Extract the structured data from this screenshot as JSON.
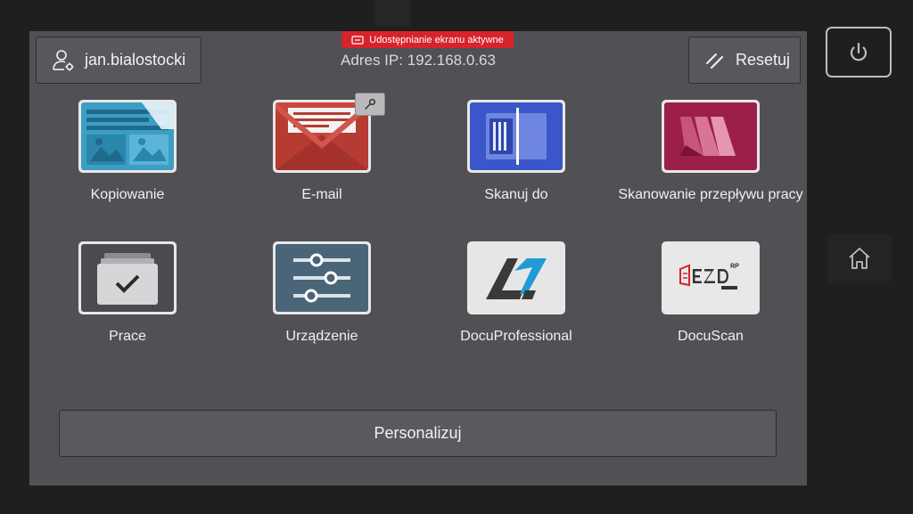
{
  "header": {
    "user_name": "jan.bialostocki",
    "ip_address": "Adres IP: 192.168.0.63",
    "share_banner": "Udostępnianie ekranu aktywne",
    "reset_label": "Resetuj"
  },
  "apps": [
    {
      "label": "Kopiowanie",
      "icon": "copy-icon"
    },
    {
      "label": "E-mail",
      "icon": "email-icon"
    },
    {
      "label": "Skanuj do",
      "icon": "scan-to-icon"
    },
    {
      "label": "Skanowanie przepływu pracy",
      "icon": "workflow-scan-icon"
    },
    {
      "label": "Prace",
      "icon": "jobs-icon"
    },
    {
      "label": "Urządzenie",
      "icon": "device-icon"
    },
    {
      "label": "DocuProfessional",
      "icon": "docuprofessional-logo"
    },
    {
      "label": "DocuScan",
      "icon": "docuscan-logo"
    }
  ],
  "footer": {
    "personalize_label": "Personalizuj"
  },
  "side": {
    "power_icon": "power-icon",
    "home_icon": "home-icon"
  },
  "colors": {
    "screen_bg": "#515155",
    "banner_red": "#d7232b",
    "bezel": "#1f1f1f"
  }
}
